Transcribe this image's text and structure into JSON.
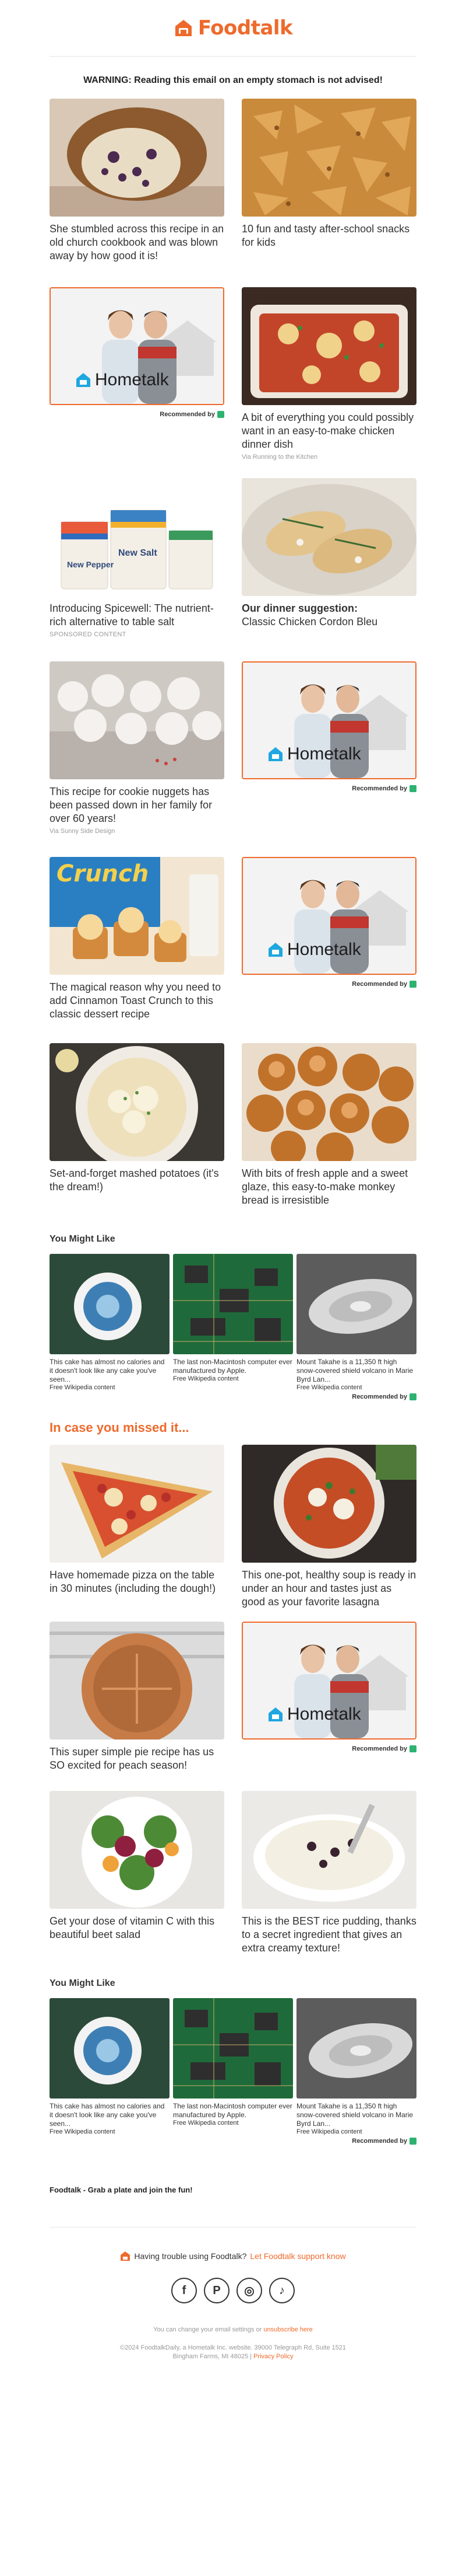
{
  "brand": {
    "name": "Foodtalk",
    "color": "#ee6a2c"
  },
  "warning": "WARNING: Reading this email on an empty stomach is not advised!",
  "ad": {
    "brand": "Hometalk",
    "recommended": "Recommended by"
  },
  "articles": [
    {
      "title": "She stumbled across this recipe in an old church cookbook and was blown away by how good it is!",
      "sub": ""
    },
    {
      "title": "10 fun and tasty after-school snacks for kids",
      "sub": ""
    },
    {
      "title": "A bit of everything you could possibly want in an easy-to-make chicken dinner dish",
      "sub": "Via Running to the Kitchen"
    },
    {
      "title": "Introducing Spicewell: The nutrient-rich alternative to table salt",
      "sub": "SPONSORED CONTENT"
    },
    {
      "title": "Our dinner suggestion:",
      "title2": "Classic Chicken Cordon Bleu",
      "sub": ""
    },
    {
      "title": "This recipe for cookie nuggets has been passed down in her family for over 60 years!",
      "sub": "Via Sunny Side Design"
    },
    {
      "title": "The magical reason why you need to add Cinnamon Toast Crunch to this classic dessert recipe",
      "sub": ""
    },
    {
      "title": "Set-and-forget mashed potatoes (it's the dream!)",
      "sub": ""
    },
    {
      "title": "With bits of fresh apple and a sweet glaze, this easy-to-make monkey bread is irresistible",
      "sub": ""
    }
  ],
  "you_might_like": {
    "heading": "You Might Like",
    "items": [
      {
        "title": "This cake has almost no calories and it doesn't look like any cake you've seen...",
        "sub": "Free Wikipedia content"
      },
      {
        "title": "The last non-Macintosh computer ever manufactured by Apple.",
        "sub": "Free Wikipedia content"
      },
      {
        "title": "Mount Takahe is a 11,350 ft high snow-covered shield volcano in Marie Byrd Lan...",
        "sub": "Free Wikipedia content"
      }
    ],
    "recommended": "Recommended by"
  },
  "missed_heading": "In case you missed it...",
  "missed": [
    {
      "title": "Have homemade pizza on the table in 30 minutes (including the dough!)"
    },
    {
      "title": "This one-pot, healthy soup is ready in under an hour and tastes just as good as your favorite lasagna"
    },
    {
      "title": "This super simple pie recipe has us SO excited for peach season!"
    },
    {
      "title": "Get your dose of vitamin C with this beautiful beet salad"
    },
    {
      "title": "This is the BEST rice pudding, thanks to a secret ingredient that gives an extra creamy texture!"
    }
  ],
  "spicewell": {
    "brand_text": "Spicewell",
    "product1": "New Pepper",
    "product2": "New Salt"
  },
  "cereal_text": "Crunch",
  "tagline": "Foodtalk - Grab a plate and join the fun!",
  "footer": {
    "trouble": "Having trouble using Foodtalk?",
    "support_link": "Let Foodtalk support know",
    "settings_text": "You can change your email settings or",
    "unsubscribe": "unsubscribe here",
    "copyright": "©2024 FoodtalkDaily, a Hometalk Inc. website. 39000 Telegraph Rd, Suite 1521",
    "address2": "Bingham Farms, MI 48025 |",
    "privacy": "Privacy Policy",
    "socials": [
      {
        "name": "facebook-icon",
        "glyph": "f"
      },
      {
        "name": "pinterest-icon",
        "glyph": "P"
      },
      {
        "name": "instagram-icon",
        "glyph": "◎"
      },
      {
        "name": "tiktok-icon",
        "glyph": "♪"
      }
    ]
  }
}
